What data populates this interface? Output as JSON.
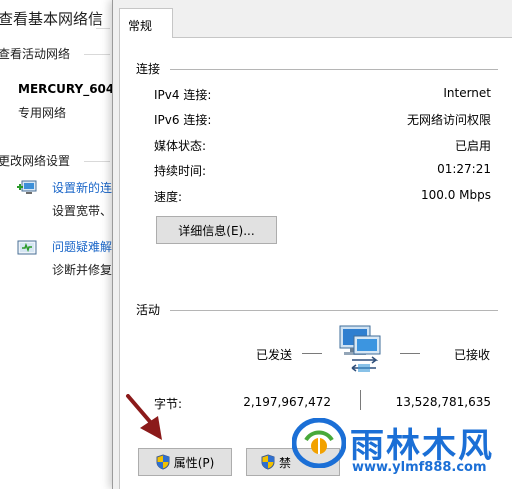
{
  "background": {
    "title": "查看基本网络信",
    "active_networks_label": "查看活动网络",
    "network_name": "MERCURY_604",
    "network_type": "专用网络",
    "change_settings_label": "更改网络设置",
    "setup_link": "设置新的连",
    "setup_desc": "设置宽带、",
    "troubleshoot_link": "问题疑难解",
    "troubleshoot_desc": "诊断并修复"
  },
  "dialog": {
    "tab_label": "常规",
    "connection": {
      "group_title": "连接",
      "rows": [
        {
          "label": "IPv4 连接:",
          "value": "Internet"
        },
        {
          "label": "IPv6 连接:",
          "value": "无网络访问权限"
        },
        {
          "label": "媒体状态:",
          "value": "已启用"
        },
        {
          "label": "持续时间:",
          "value": "01:27:21"
        },
        {
          "label": "速度:",
          "value": "100.0 Mbps"
        }
      ],
      "details_button": "详细信息(E)..."
    },
    "activity": {
      "group_title": "活动",
      "sent_label": "已发送",
      "received_label": "已接收",
      "bytes_label": "字节:",
      "bytes_sent": "2,197,967,472",
      "bytes_received": "13,528,781,635"
    },
    "properties_button": "属性(P)",
    "disable_button": "禁"
  },
  "watermark": {
    "text": "雨林木风",
    "url": "www.ylmf888.com"
  },
  "colors": {
    "link": "#1a66c8",
    "arrow": "#8b1a1a",
    "watermark": "#1b6fd6"
  }
}
